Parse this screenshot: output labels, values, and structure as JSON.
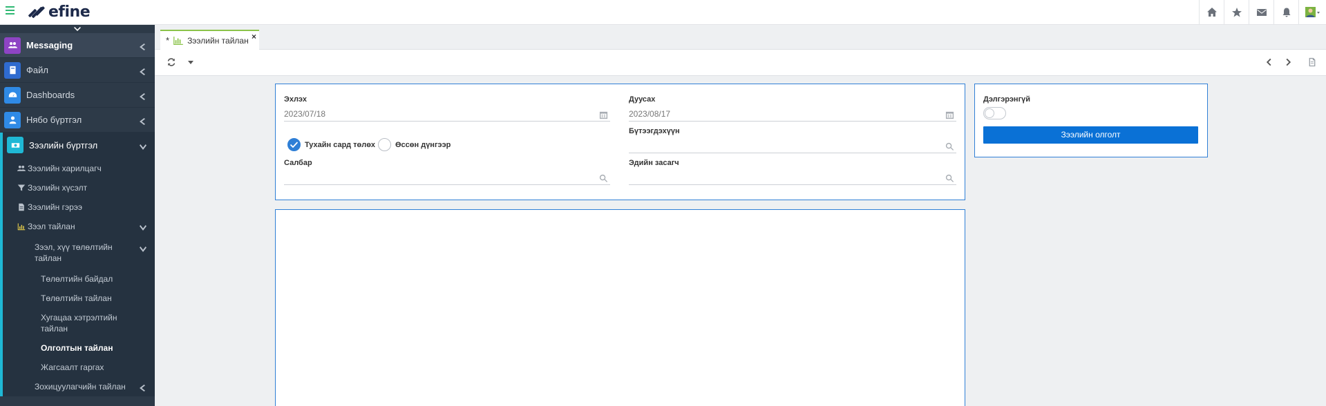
{
  "app": {
    "logo_text": "efine"
  },
  "topbar": {
    "icons": [
      "home-icon",
      "star-icon",
      "mail-icon",
      "bell-icon",
      "user-avatar-icon"
    ]
  },
  "sidebar": {
    "items": [
      {
        "label": "Messaging",
        "icon": "users-icon",
        "color": "#8e44c4"
      },
      {
        "label": "Файл",
        "icon": "file-icon",
        "color": "#2f6bcf"
      },
      {
        "label": "Dashboards",
        "icon": "gauge-icon",
        "color": "#2f8ae6"
      },
      {
        "label": "Нябо бүртгэл",
        "icon": "user-icon",
        "color": "#2f8ae6"
      }
    ],
    "group": {
      "label": "Зээлийн бүртгэл",
      "icon": "money-icon",
      "color": "#1fb8d5",
      "children": [
        {
          "label": "Зээлийн харилцагч",
          "icon": "users-icon"
        },
        {
          "label": "Зээлийн хүсэлт",
          "icon": "filter-icon"
        },
        {
          "label": "Зээлийн гэрээ",
          "icon": "doc-icon"
        },
        {
          "label": "Зээл тайлан",
          "icon": "chart-icon"
        }
      ],
      "report_group": "Зээл, хүү төлөлтийн тайлан",
      "report_children": [
        "Төлөлтийн байдал",
        "Төлөлтийн тайлан",
        "Хугацаа хэтрэлтийн тайлан",
        "Олголтын тайлан",
        "Жагсаалт гаргах"
      ],
      "manager_report": "Зохицуулагчийн тайлан"
    }
  },
  "tabs": [
    {
      "label": "Зээлийн тайлан",
      "modified_marker": "*",
      "close": "×"
    }
  ],
  "form": {
    "start_label": "Эхлэх",
    "start_value": "2023/07/18",
    "end_label": "Дуусах",
    "end_value": "2023/08/17",
    "radio_1": "Тухайн сард төлөх",
    "radio_2": "Өссөн дүнгээр",
    "product_label": "Бүтээгдэхүүн",
    "branch_label": "Салбар",
    "economist_label": "Эдийн засагч"
  },
  "side_panel": {
    "detail_label": "Дэлгэрэнгүй",
    "detail_toggle_on": false,
    "button_label": "Зээлийн олголт"
  },
  "colors": {
    "sidebar_bg": "#2d3a48",
    "accent": "#2f7fd6",
    "primary_button": "#0a71d6",
    "tab_accent": "#8bc34a",
    "hamburger": "#2eb872"
  }
}
